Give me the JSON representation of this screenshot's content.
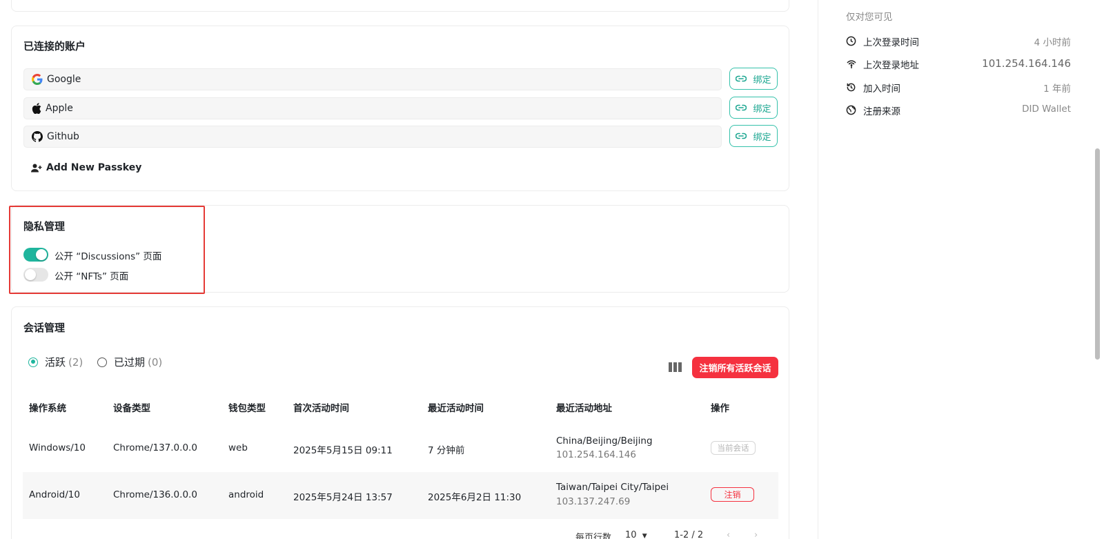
{
  "connected_accounts": {
    "title": "已连接的账户",
    "accounts": [
      {
        "name": "Google",
        "icon": "google-icon"
      },
      {
        "name": "Apple",
        "icon": "apple-icon"
      },
      {
        "name": "Github",
        "icon": "github-icon"
      }
    ],
    "bind_label": "绑定",
    "add_passkey": "Add New Passkey"
  },
  "privacy": {
    "title": "隐私管理",
    "toggles": [
      {
        "label": "公开 “Discussions” 页面",
        "on": true
      },
      {
        "label": "公开 “NFTs” 页面",
        "on": false
      }
    ]
  },
  "sessions": {
    "title": "会话管理",
    "filters": [
      {
        "label": "活跃",
        "count": "(2)",
        "selected": true
      },
      {
        "label": "已过期",
        "count": "(0)",
        "selected": false
      }
    ],
    "revoke_all": "注销所有活跃会话",
    "columns": [
      "操作系统",
      "设备类型",
      "钱包类型",
      "首次活动时间",
      "最近活动时间",
      "最近活动地址",
      "操作"
    ],
    "rows": [
      {
        "os": "Windows/10",
        "device": "Chrome/137.0.0.0",
        "wallet": "web",
        "first": "2025年5月15日 09:11",
        "last": "7 分钟前",
        "location": "China/Beijing/Beijing",
        "ip": "101.254.164.146",
        "action": "当前会话"
      },
      {
        "os": "Android/10",
        "device": "Chrome/136.0.0.0",
        "wallet": "android",
        "first": "2025年5月24日 13:57",
        "last": "2025年6月2日 11:30",
        "location": "Taiwan/Taipei City/Taipei",
        "ip": "103.137.247.69",
        "action": "注销"
      }
    ],
    "pagination": {
      "rows_per_page_label": "每页行数",
      "rows_per_page": "10",
      "range": "1-2 / 2"
    }
  },
  "sidebar": {
    "visibility_note": "仅对您可见",
    "info": [
      {
        "label": "上次登录时间",
        "value": "4 小时前",
        "icon": "clock-icon"
      },
      {
        "label": "上次登录地址",
        "value": "101.254.164.146",
        "icon": "signal-icon"
      },
      {
        "label": "加入时间",
        "value": "1 年前",
        "icon": "history-icon"
      },
      {
        "label": "注册来源",
        "value": "DID Wallet",
        "icon": "globe-icon"
      }
    ]
  },
  "colors": {
    "accent": "#1fb59d",
    "danger": "#f5313f",
    "highlight": "#e53935"
  }
}
